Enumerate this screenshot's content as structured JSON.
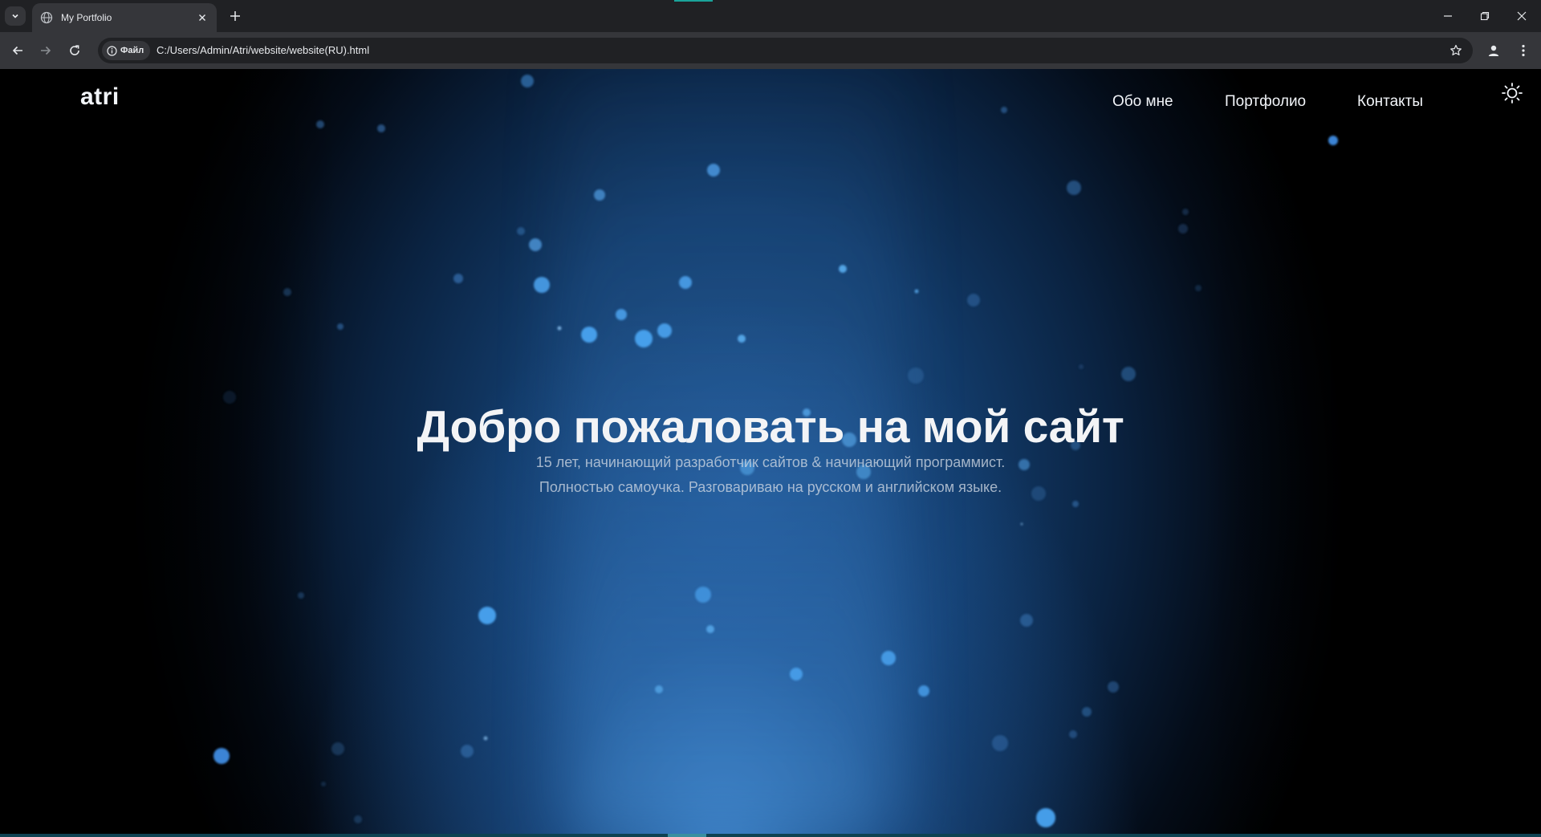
{
  "browser": {
    "tab_title": "My Portfolio",
    "site_info_label": "Файл",
    "url": "C:/Users/Admin/Atri/website/website(RU).html"
  },
  "site": {
    "logo": "atri",
    "nav": [
      {
        "label": "Обо мне"
      },
      {
        "label": "Портфолио"
      },
      {
        "label": "Контакты"
      }
    ],
    "theme_toggle_icon": "sun-icon"
  },
  "hero": {
    "title": "Добро пожаловать на мой сайт",
    "subtitle_line1": "15 лет, начинающий разработчик сайтов & начинающий программист.",
    "subtitle_line2": "Полностью самоучка. Разговариваю на русском и английском языке."
  },
  "colors": {
    "chrome_dark": "#202124",
    "chrome_toolbar": "#35363a",
    "accent_teal": "#1aa39a",
    "particle": "#4aa3f0"
  }
}
